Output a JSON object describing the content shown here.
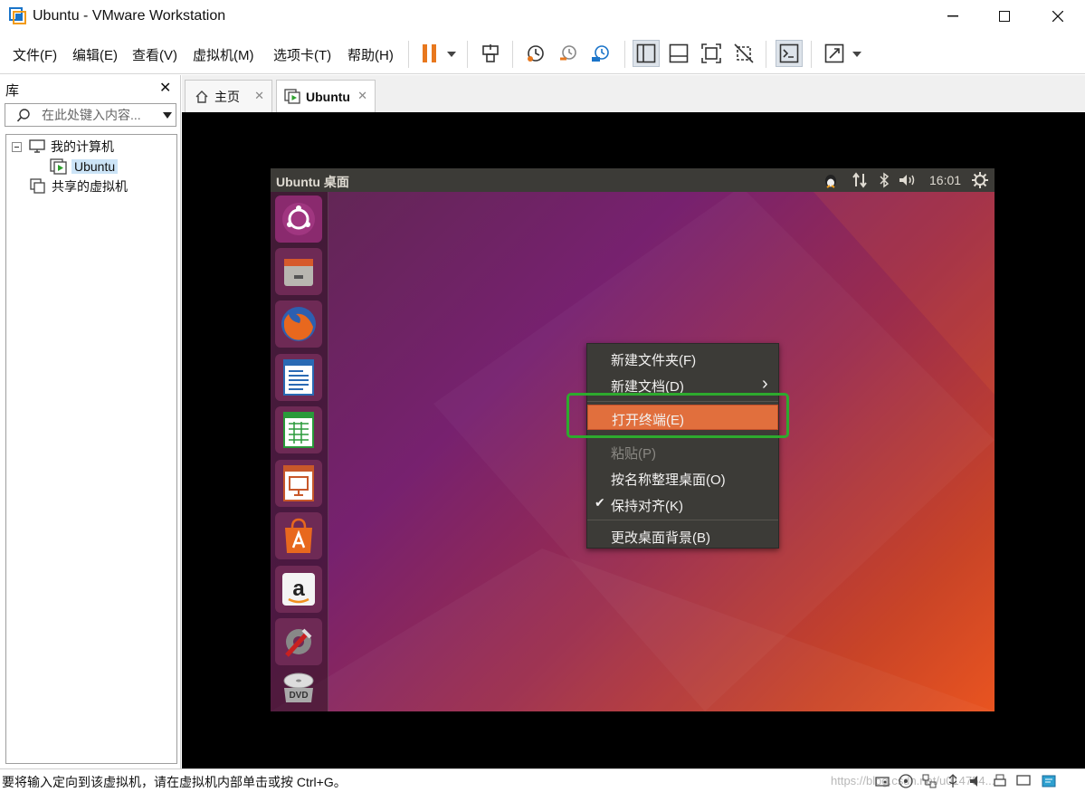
{
  "window": {
    "title": "Ubuntu - VMware Workstation",
    "controls": {
      "minimize": "—",
      "maximize": "☐",
      "close": "✕"
    }
  },
  "menubar": {
    "items": [
      "文件(F)",
      "编辑(E)",
      "查看(V)",
      "虚拟机(M)",
      "选项卡(T)",
      "帮助(H)"
    ]
  },
  "toolbar": {
    "icons": [
      "pause-icon",
      "send-ctrl-alt-del-icon",
      "snapshot-icon",
      "revert-snapshot-icon",
      "snapshot-manager-icon",
      "library-view-icon",
      "thumbnail-view-icon",
      "fullscreen-icon",
      "unity-icon",
      "console-icon",
      "stretch-icon"
    ],
    "accent_color": "#e8781e"
  },
  "library": {
    "title": "库",
    "close": "✕",
    "search_placeholder": "在此处键入内容...",
    "tree": {
      "root": "我的计算机",
      "child": "Ubuntu",
      "shared": "共享的虚拟机"
    }
  },
  "tabs": [
    {
      "label": "主页",
      "close": "✕"
    },
    {
      "label": "Ubuntu",
      "close": "✕"
    }
  ],
  "guest": {
    "top_title": "Ubuntu 桌面",
    "clock": "16:01",
    "indicators": [
      "tux-icon",
      "network-icon",
      "bluetooth-icon",
      "volume-icon",
      "settings-gear-icon"
    ],
    "launcher": [
      "ubuntu-dash-icon",
      "files-icon",
      "firefox-icon",
      "libreoffice-writer-icon",
      "libreoffice-calc-icon",
      "libreoffice-impress-icon",
      "software-center-icon",
      "amazon-icon",
      "system-settings-icon",
      "dvd-icon"
    ],
    "context_menu": {
      "items": [
        {
          "label": "新建文件夹(F)",
          "state": "normal"
        },
        {
          "label": "新建文档(D)",
          "state": "submenu",
          "arrow": "›"
        },
        {
          "label": "打开终端(E)",
          "state": "highlight"
        },
        {
          "label": "粘贴(P)",
          "state": "disabled"
        },
        {
          "label": "按名称整理桌面(O)",
          "state": "normal"
        },
        {
          "label": "保持对齐(K)",
          "state": "checked",
          "check": "✔"
        },
        {
          "label": "更改桌面背景(B)",
          "state": "normal"
        }
      ],
      "highlight_color": "#e16f3d",
      "annotation_color": "#2eaa2e"
    }
  },
  "statusbar": {
    "message": "要将输入定向到该虚拟机，请在虚拟机内部单击或按 Ctrl+G。",
    "watermark": "https://blog.csdn.net/u014754..."
  }
}
